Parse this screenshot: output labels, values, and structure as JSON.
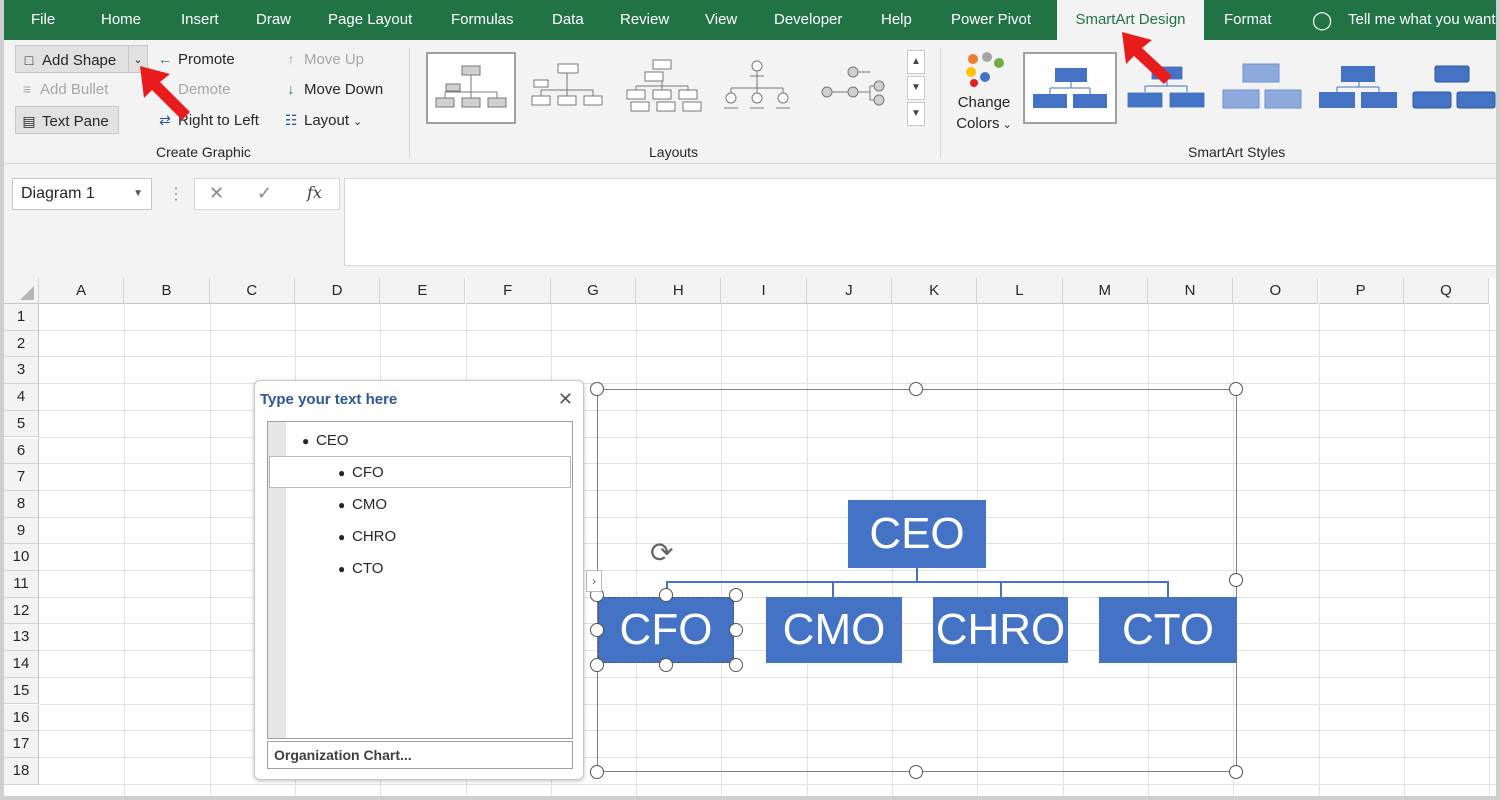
{
  "menu": {
    "tabs": [
      "File",
      "Home",
      "Insert",
      "Draw",
      "Page Layout",
      "Formulas",
      "Data",
      "Review",
      "View",
      "Developer",
      "Help",
      "Power Pivot",
      "SmartArt Design",
      "Format"
    ],
    "active_tab": "SmartArt Design",
    "tell_me": "Tell me what you want to do"
  },
  "ribbon": {
    "create_graphic": {
      "add_shape": "Add Shape",
      "add_bullet": "Add Bullet",
      "text_pane": "Text Pane",
      "promote": "Promote",
      "demote": "Demote",
      "right_to_left": "Right to Left",
      "move_up": "Move Up",
      "move_down": "Move Down",
      "layout": "Layout",
      "group_label": "Create Graphic"
    },
    "layouts": {
      "group_label": "Layouts"
    },
    "styles": {
      "change_colors_1": "Change",
      "change_colors_2": "Colors",
      "group_label": "SmartArt Styles"
    }
  },
  "formula_bar": {
    "name_box": "Diagram 1",
    "fx": "fx"
  },
  "sheet": {
    "columns": [
      "A",
      "B",
      "C",
      "D",
      "E",
      "F",
      "G",
      "H",
      "I",
      "J",
      "K",
      "L",
      "M",
      "N",
      "O",
      "P",
      "Q"
    ],
    "rows": [
      "1",
      "2",
      "3",
      "4",
      "5",
      "6",
      "7",
      "8",
      "9",
      "10",
      "11",
      "12",
      "13",
      "14",
      "15",
      "16",
      "17",
      "18"
    ]
  },
  "text_pane": {
    "title": "Type your text here",
    "items": [
      "CEO",
      "CFO",
      "CMO",
      "CHRO",
      "CTO"
    ],
    "footer": "Organization Chart..."
  },
  "smartart": {
    "top": "CEO",
    "children": [
      "CFO",
      "CMO",
      "CHRO",
      "CTO"
    ],
    "colors": {
      "node": "#4472c4",
      "ribbon_green": "#217346",
      "annotation": "#e81c1c"
    }
  }
}
